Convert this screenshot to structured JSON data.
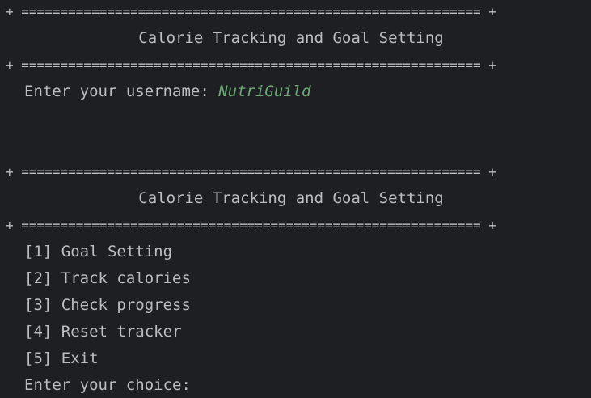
{
  "screen1": {
    "border_top": "+ =========================================================== +",
    "title": "Calorie Tracking and Goal Setting",
    "border_bottom": "+ =========================================================== +",
    "prompt": "Enter your username: ",
    "username_value": "NutriGuild"
  },
  "screen2": {
    "border_top": "+ =========================================================== +",
    "title": "Calorie Tracking and Goal Setting",
    "border_bottom": "+ =========================================================== +",
    "menu": [
      "[1] Goal Setting",
      "[2] Track calories",
      "[3] Check progress",
      "[4] Reset tracker",
      "[5] Exit"
    ],
    "choice_prompt": "Enter your choice: "
  },
  "colors": {
    "background": "#1e1f22",
    "text": "#bcbec4",
    "user_input": "#6aab73"
  }
}
